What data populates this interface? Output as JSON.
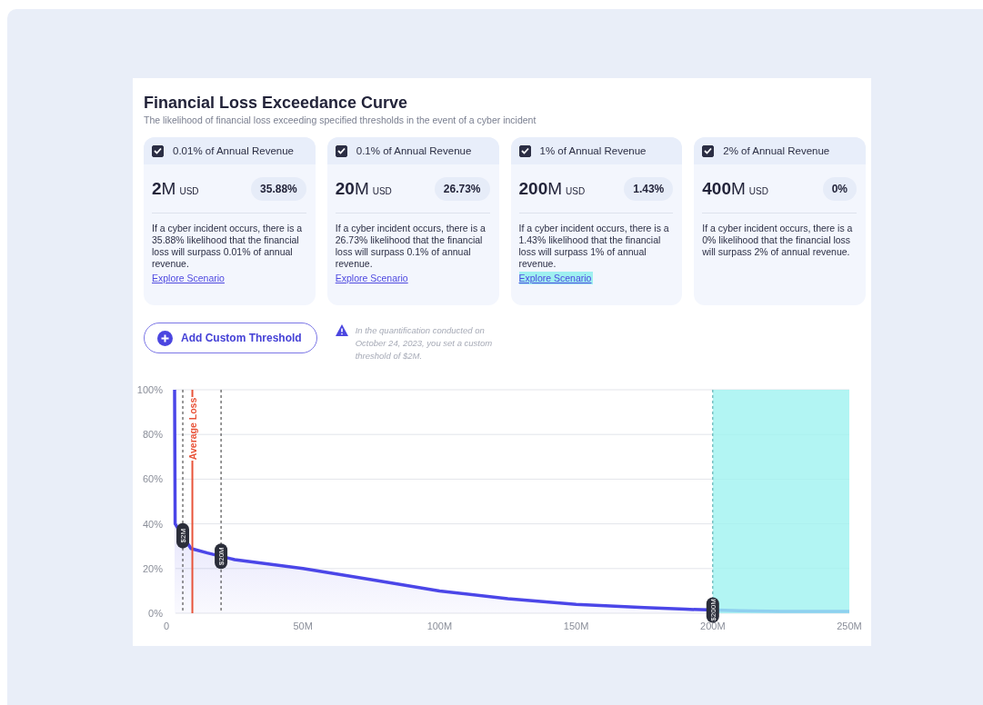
{
  "title": "Financial Loss Exceedance Curve",
  "subtitle": "The likelihood of financial loss exceeding specified thresholds in the event of a cyber incident",
  "cards": [
    {
      "label": "0.01% of Annual Revenue",
      "checked": true,
      "amount": "2",
      "unit": "M",
      "currency": "USD",
      "percent": "35.88%",
      "description": "If a cyber incident occurs, there is a 35.88% likelihood that the financial loss will surpass 0.01% of annual revenue.",
      "link": {
        "text": "Explore Scenario",
        "highlighted": false
      }
    },
    {
      "label": "0.1% of Annual Revenue",
      "checked": true,
      "amount": "20",
      "unit": "M",
      "currency": "USD",
      "percent": "26.73%",
      "description": "If a cyber incident occurs, there is a 26.73% likelihood that the financial loss will surpass 0.1% of annual revenue.",
      "link": {
        "text": "Explore Scenario",
        "highlighted": false
      }
    },
    {
      "label": "1% of Annual Revenue",
      "checked": true,
      "amount": "200",
      "unit": "M",
      "currency": "USD",
      "percent": "1.43%",
      "description": "If a cyber incident occurs, there is a 1.43% likelihood that the financial loss will surpass 1% of annual revenue.",
      "link": {
        "text": "Explore Scenario",
        "highlighted": true
      }
    },
    {
      "label": "2% of Annual Revenue",
      "checked": true,
      "amount": "400",
      "unit": "M",
      "currency": "USD",
      "percent": "0%",
      "description": "If a cyber incident occurs, there is a 0% likelihood that the financial loss will surpass 2% of annual revenue."
    }
  ],
  "add_button": {
    "label": "Add Custom Threshold"
  },
  "notice": {
    "text": "In the quantification conducted on October 24, 2023, you set a custom threshold of $2M."
  },
  "chart_data": {
    "type": "area",
    "x": [
      3,
      3.2,
      9,
      15,
      25,
      50,
      75,
      100,
      125,
      150,
      175,
      190,
      210,
      225,
      250
    ],
    "series": [
      {
        "color": "#4b46e8",
        "values": [
          100,
          40,
          29,
          27,
          24,
          20,
          15,
          10,
          6.5,
          4,
          2.5,
          1.8,
          1.1,
          0.8,
          0.8
        ]
      }
    ],
    "grid": true,
    "xlim": [
      0,
      250
    ],
    "ylim": [
      0,
      100
    ],
    "xticks": [
      {
        "value": 0,
        "label": "0"
      },
      {
        "value": 50,
        "label": "50M"
      },
      {
        "value": 100,
        "label": "100M"
      },
      {
        "value": 150,
        "label": "150M"
      },
      {
        "value": 200,
        "label": "200M"
      },
      {
        "value": 250,
        "label": "250M"
      }
    ],
    "yticks": [
      {
        "value": 0,
        "label": "0%"
      },
      {
        "value": 20,
        "label": "20%"
      },
      {
        "value": 40,
        "label": "40%"
      },
      {
        "value": 60,
        "label": "60%"
      },
      {
        "value": 80,
        "label": "80%"
      },
      {
        "value": 100,
        "label": "100%"
      }
    ],
    "ref_lines": [
      {
        "axis": "x",
        "value": 6,
        "label": "$2M",
        "color": "#333333"
      },
      {
        "axis": "x",
        "value": 20,
        "label": "$20M",
        "color": "#333333"
      },
      {
        "axis": "x",
        "value": 9.5,
        "label": "Average Loss",
        "color": "#e8543a"
      },
      {
        "axis": "x",
        "value": 200,
        "label": "$200M",
        "color": "#4aa6a8"
      }
    ],
    "bands": [
      {
        "axis": "x",
        "from": 200,
        "to": 250,
        "color": "#9ff3f0"
      }
    ]
  }
}
